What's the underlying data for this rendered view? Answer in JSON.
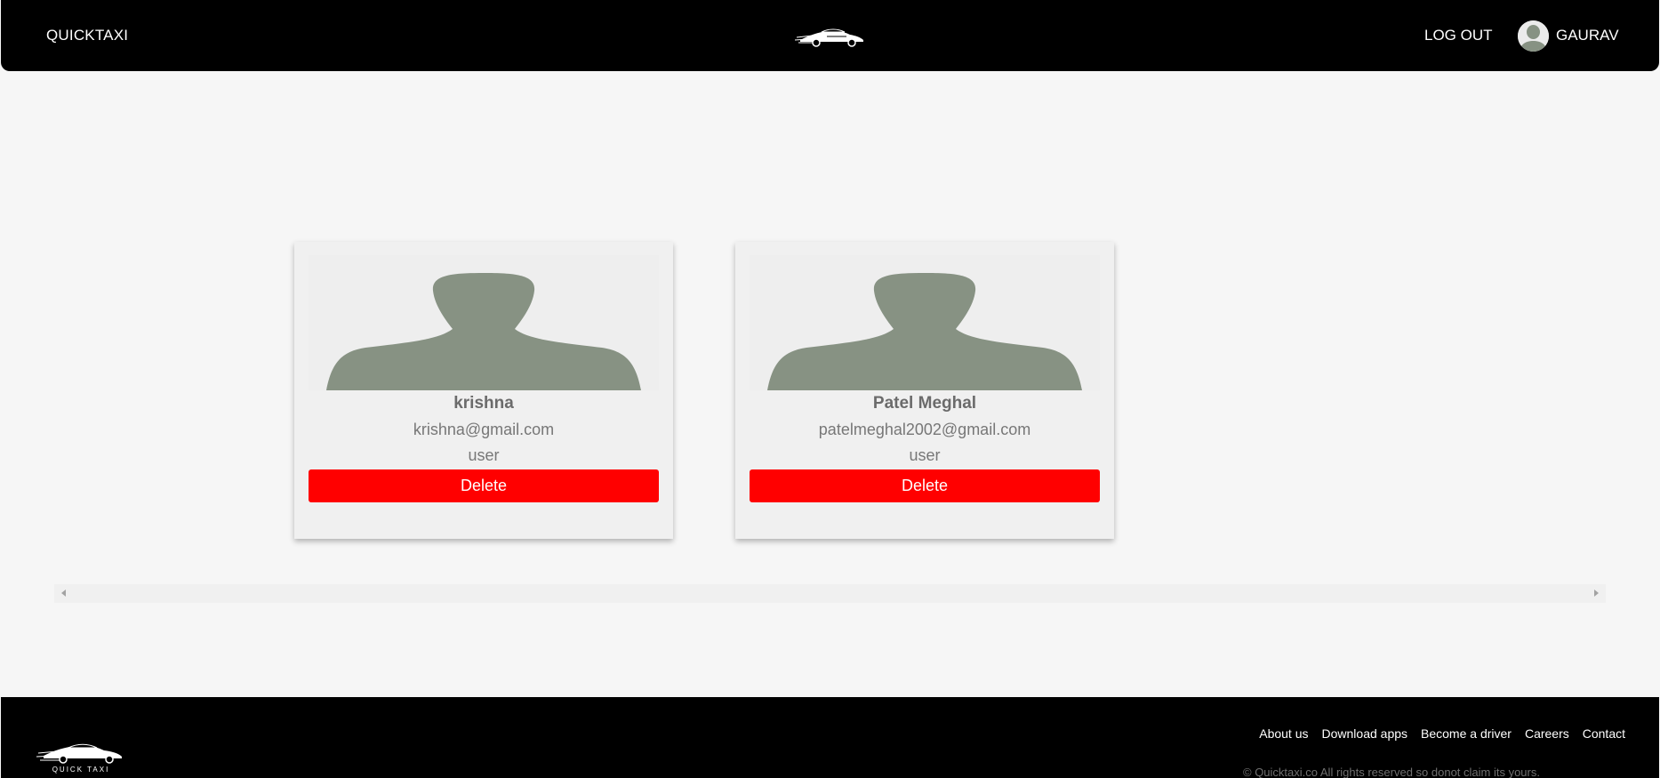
{
  "header": {
    "brand": "QUICKTAXI",
    "logout_label": "LOG OUT",
    "username": "GAURAV"
  },
  "users": [
    {
      "name": "krishna",
      "email": "krishna@gmail.com",
      "role": "user",
      "delete_label": "Delete"
    },
    {
      "name": "Patel Meghal",
      "email": "patelmeghal2002@gmail.com",
      "role": "user",
      "delete_label": "Delete"
    }
  ],
  "footer": {
    "logo_text": "QUICK TAXI",
    "links": [
      "About us",
      "Download apps",
      "Become a driver",
      "Careers",
      "Contact"
    ],
    "copyright": "© Quicktaxi.co All rights reserved so donot claim its yours."
  },
  "colors": {
    "header_bg": "#000000",
    "page_bg": "#f6f6f6",
    "card_bg": "#f0f0f0",
    "delete_button": "#ff0000",
    "avatar_silhouette": "#879283"
  },
  "icons": {
    "header_logo": "taxi-car-logo-icon",
    "avatar": "user-silhouette-icon",
    "scroll_left": "scroll-left-arrow-icon",
    "scroll_right": "scroll-right-arrow-icon"
  }
}
